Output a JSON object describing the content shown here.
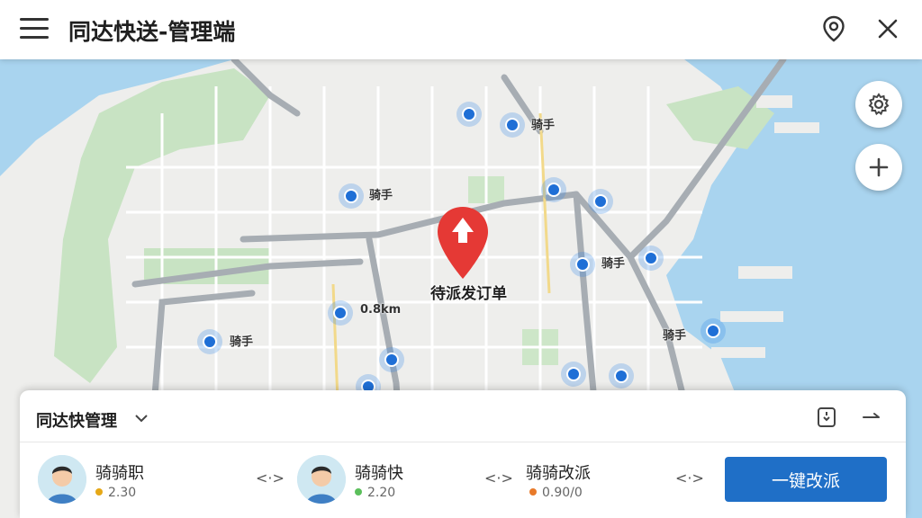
{
  "header": {
    "title": "同达快送-管理端",
    "menu_icon": "menu-icon",
    "location_icon": "location-pin-icon",
    "close_icon": "close-icon"
  },
  "map": {
    "order_label": "待派发订单",
    "pins": [
      {
        "label": ""
      },
      {
        "label": "骑手"
      },
      {
        "label": "骑手"
      },
      {
        "label": ""
      },
      {
        "label": ""
      },
      {
        "label": "骑手"
      },
      {
        "label": ""
      },
      {
        "label": "0.8km"
      },
      {
        "label": "骑手"
      },
      {
        "label": "骑手"
      },
      {
        "label": ""
      },
      {
        "label": ""
      },
      {
        "label": ""
      },
      {
        "label": ""
      }
    ],
    "controls": {
      "settings_icon": "gear-icon",
      "zoom_icon": "plus-icon"
    }
  },
  "panel": {
    "title": "同达快管理",
    "riders": [
      {
        "name": "骑骑职",
        "status": "2.30",
        "dot_color": "#e6a817"
      },
      {
        "name": "骑骑快",
        "status": "2.20",
        "dot_color": "#5bbf5b"
      },
      {
        "name": "骑骑改派",
        "status": "0.90/0",
        "dot_color": "#e87a2a"
      }
    ],
    "swap_symbols": [
      "<·>",
      "<·>",
      "<·>"
    ],
    "reassign_button": "一键改派"
  },
  "colors": {
    "accent": "#1f6fc7",
    "order_marker": "#e53935",
    "pin": "#1f6fd6",
    "water": "#a9d4ef"
  }
}
